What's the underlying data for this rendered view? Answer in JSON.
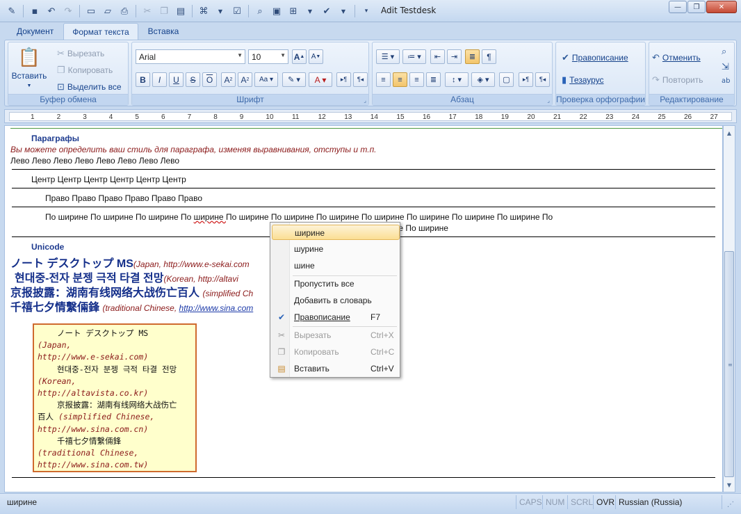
{
  "window": {
    "title": "Adit Testdesk"
  },
  "qat": {
    "icons": [
      "edit-icon",
      "save-icon",
      "undo-icon",
      "redo-icon",
      "new-icon",
      "open-icon",
      "print-icon",
      "cut-icon",
      "copy-icon",
      "paste-icon",
      "format-painter-icon",
      "check-icon",
      "find-icon",
      "picture-icon",
      "table-icon",
      "spell-icon",
      "customize-icon"
    ]
  },
  "tabs": [
    "Документ",
    "Формат текста",
    "Вставка"
  ],
  "ribbon": {
    "clipboard": {
      "label": "Буфер обмена",
      "paste": "Вставить",
      "cut": "Вырезать",
      "copy": "Копировать",
      "select_all": "Выделить все"
    },
    "font": {
      "label": "Шрифт",
      "family": "Arial",
      "size": "10",
      "buttons": [
        "B",
        "I",
        "U",
        "S",
        "O"
      ]
    },
    "paragraph": {
      "label": "Абзац"
    },
    "spelling": {
      "label": "Проверка орфографии",
      "spell": "Правописание",
      "thesaurus": "Тезаурус"
    },
    "editing": {
      "label": "Редактирование",
      "undo": "Отменить",
      "redo": "Повторить"
    }
  },
  "ruler": {
    "ticks": [
      "1",
      "2",
      "3",
      "4",
      "5",
      "6",
      "7",
      "8",
      "9",
      "10",
      "11",
      "12",
      "13",
      "14",
      "15",
      "16",
      "17",
      "18",
      "19",
      "20",
      "21",
      "22",
      "23",
      "24",
      "25",
      "26",
      "27"
    ]
  },
  "document": {
    "para_header": "Параграфы",
    "para_desc": "Вы можете определить ваш стиль для параграфа, изменяя выравнивания, отступы и т.п.",
    "left": "Лево Лево  Лево Лево  Лево Лево  Лево Лево",
    "center": "Центр Центр Центр Центр Центр Центр",
    "right": "Право Право Право Право Право Право",
    "justify1": "По ширине По ширине По ширине По ширине По ширине По ширине По ширине По ширине По ширине По ширине По ширине По",
    "justify2": "ширине По ширине",
    "unicode_header": "Unicode",
    "uni1_text": "ノート デスクトップ MS",
    "uni1_note": "(Japan, http://www.e-sekai.com",
    "uni2_text": "현대중-전자 분젱 극적 타결 전망",
    "uni2_note": "(Korean, http://altavi",
    "uni3_text": "京报披露：湖南有线网络大战伤亡百人",
    "uni3_note": "(simplified Ch",
    "uni4_text": "千禧七夕情繫倆鋒",
    "uni4_note": "(traditional Chinese, ",
    "uni4_link": "http://www.sina.com",
    "box": {
      "l1": "ノート デスクトップ MS",
      "l2": "(Japan,",
      "l3": "http://www.e-sekai.com)",
      "l4": "현대중-전자 분젱 극적 타결 전망",
      "l5": "(Korean,",
      "l6": "http://altavista.co.kr)",
      "l7": "京报披露：湖南有线网络大战伤亡",
      "l8a": "百人",
      "l8b": "(simplified Chinese,",
      "l9": "http://www.sina.com.cn)",
      "l10": "千禧七夕情繫倆鋒",
      "l11": "(traditional Chinese,",
      "l12": "http://www.sina.com.tw)"
    }
  },
  "context_menu": {
    "suggestions": [
      "ширине",
      "шурине",
      "шине"
    ],
    "skip_all": "Пропустить все",
    "add_dict": "Добавить в словарь",
    "spelling": "Правописание",
    "spelling_key": "F7",
    "cut": "Вырезать",
    "cut_key": "Ctrl+X",
    "copy": "Копировать",
    "copy_key": "Ctrl+C",
    "paste": "Вставить",
    "paste_key": "Ctrl+V"
  },
  "status": {
    "word": "ширине",
    "caps": "CAPS",
    "num": "NUM",
    "scrl": "SCRL",
    "ovr": "OVR",
    "language": "Russian (Russia)"
  }
}
